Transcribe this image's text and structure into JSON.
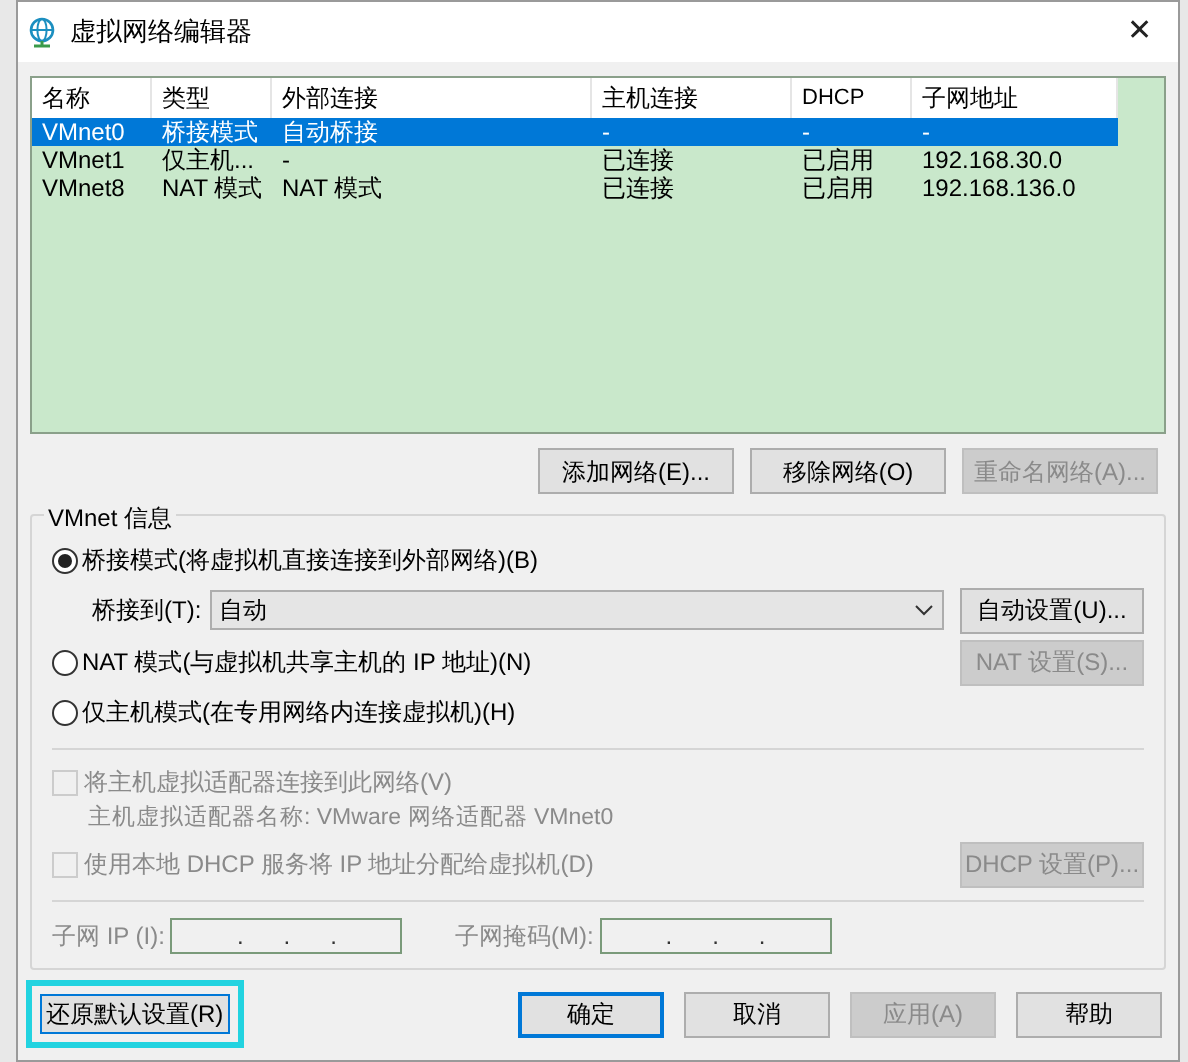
{
  "window": {
    "title": "虚拟网络编辑器",
    "close": "✕"
  },
  "table": {
    "columns": [
      "名称",
      "类型",
      "外部连接",
      "主机连接",
      "DHCP",
      "子网地址"
    ],
    "rows": [
      {
        "cells": [
          "VMnet0",
          "桥接模式",
          "自动桥接",
          "-",
          "-",
          "-"
        ],
        "selected": true
      },
      {
        "cells": [
          "VMnet1",
          "仅主机...",
          "-",
          "已连接",
          "已启用",
          "192.168.30.0"
        ],
        "selected": false
      },
      {
        "cells": [
          "VMnet8",
          "NAT 模式",
          "NAT 模式",
          "已连接",
          "已启用",
          "192.168.136.0"
        ],
        "selected": false
      }
    ]
  },
  "table_buttons": [
    {
      "label": "添加网络(E)...",
      "disabled": false
    },
    {
      "label": "移除网络(O)",
      "disabled": false
    },
    {
      "label": "重命名网络(A)...",
      "disabled": true
    }
  ],
  "group": {
    "title": "VMnet 信息",
    "modes": [
      {
        "label": "桥接模式(将虚拟机直接连接到外部网络)(B)",
        "selected": true
      },
      {
        "label": "NAT 模式(与虚拟机共享主机的 IP 地址)(N)",
        "selected": false
      },
      {
        "label": "仅主机模式(在专用网络内连接虚拟机)(H)",
        "selected": false
      }
    ],
    "bridge_to": {
      "label": "桥接到(T):",
      "value": "自动",
      "button": {
        "label": "自动设置(U)...",
        "disabled": false
      }
    },
    "nat_button": {
      "label": "NAT 设置(S)...",
      "disabled": true
    },
    "connect_adapter": {
      "label": "将主机虚拟适配器连接到此网络(V)",
      "checked": false,
      "disabled": true
    },
    "adapter_name": "主机虚拟适配器名称: VMware 网络适配器 VMnet0",
    "use_dhcp": {
      "label": "使用本地 DHCP 服务将 IP 地址分配给虚拟机(D)",
      "checked": false,
      "disabled": true
    },
    "dhcp_button": {
      "label": "DHCP 设置(P)...",
      "disabled": true
    },
    "subnet_ip": {
      "label": "子网 IP (I):",
      "dots": [
        ".",
        ".",
        "."
      ]
    },
    "subnet_mask": {
      "label": "子网掩码(M):",
      "dots": [
        ".",
        ".",
        "."
      ]
    }
  },
  "footer": {
    "restore": {
      "label": "还原默认设置(R)",
      "highlighted": true
    },
    "buttons": [
      {
        "label": "确定",
        "disabled": false,
        "default": true
      },
      {
        "label": "取消",
        "disabled": false,
        "default": false
      },
      {
        "label": "应用(A)",
        "disabled": true,
        "default": false
      },
      {
        "label": "帮助",
        "disabled": false,
        "default": false
      }
    ]
  }
}
